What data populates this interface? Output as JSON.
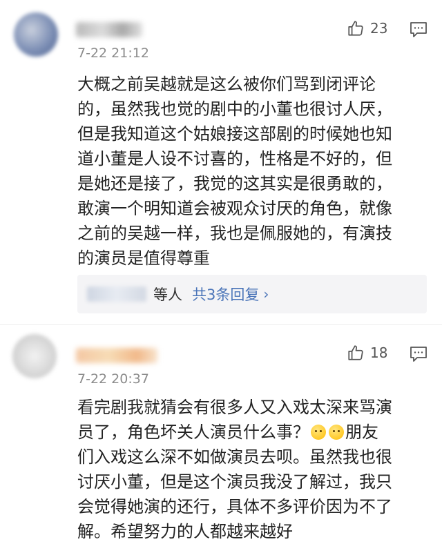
{
  "comments": [
    {
      "time": "7-22 21:12",
      "likes": "23",
      "text": "大概之前吴越就是这么被你们骂到闭评论\n的，虽然我也觉的剧中的小董也很讨人厌，\n但是我知道这个姑娘接这部剧的时候她也知\n道小董是人设不讨喜的，性格是不好的，但\n是她还是接了，我觉的这其实是很勇敢的，\n敢演一个明知道会被观众讨厌的角色，就像\n之前的吴越一样，我也是佩服她的，有演技\n的演员是值得尊重",
      "reply_suffix": "等人",
      "reply_link": "共3条回复"
    },
    {
      "time": "7-22 20:37",
      "likes": "18",
      "text_before_emoji": "看完剧我就猜会有很多人又入戏太深来骂演\n员了，角色坏关人演员什么事？",
      "text_after_emoji": "朋友\n们入戏这么深不如做演员去呗。虽然我也很\n讨厌小董，但是这个演员我没了解过，我只\n会觉得她演的还行，具体不多评价因为不了\n解。希望努力的人都越来越好"
    }
  ],
  "icons": {
    "like": "thumbs-up-icon",
    "reply": "comment-icon",
    "chevron": "chevron-right-icon",
    "emoji": "face-emoji-icon"
  },
  "colors": {
    "link": "#4a74b8",
    "meta": "#8c8c8c",
    "reply_bg": "#f4f4f6"
  }
}
